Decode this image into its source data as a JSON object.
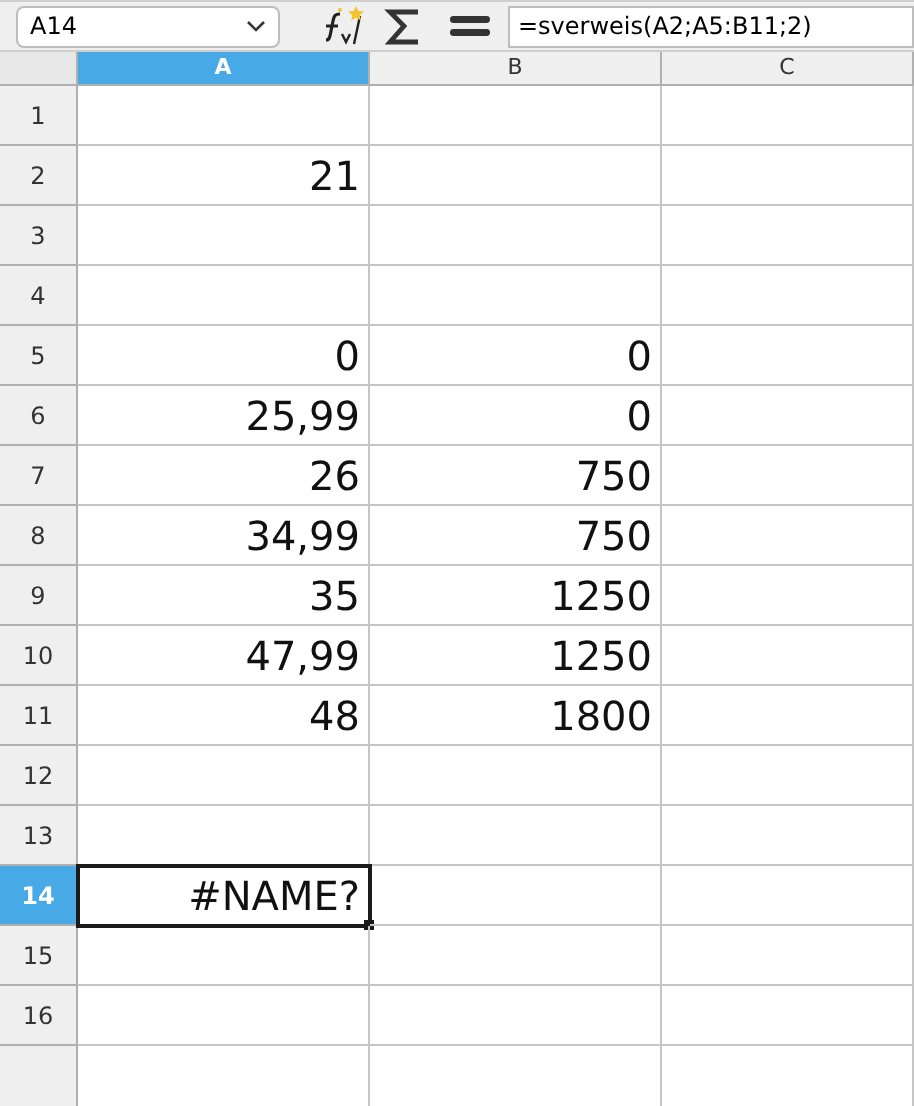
{
  "toolbar": {
    "name_box": "A14",
    "formula": "=sverweis(A2;A5:B11;2)"
  },
  "columns": [
    {
      "label": "A",
      "selected": true
    },
    {
      "label": "B",
      "selected": false
    },
    {
      "label": "C",
      "selected": false
    }
  ],
  "rows": [
    {
      "label": "1",
      "selected": false
    },
    {
      "label": "2",
      "selected": false,
      "A": "21"
    },
    {
      "label": "3",
      "selected": false
    },
    {
      "label": "4",
      "selected": false
    },
    {
      "label": "5",
      "selected": false,
      "A": "0",
      "B": "0"
    },
    {
      "label": "6",
      "selected": false,
      "A": "25,99",
      "B": "0"
    },
    {
      "label": "7",
      "selected": false,
      "A": "26",
      "B": "750"
    },
    {
      "label": "8",
      "selected": false,
      "A": "34,99",
      "B": "750"
    },
    {
      "label": "9",
      "selected": false,
      "A": "35",
      "B": "1250"
    },
    {
      "label": "10",
      "selected": false,
      "A": "47,99",
      "B": "1250"
    },
    {
      "label": "11",
      "selected": false,
      "A": "48",
      "B": "1800"
    },
    {
      "label": "12",
      "selected": false
    },
    {
      "label": "13",
      "selected": false
    },
    {
      "label": "14",
      "selected": true,
      "A": "#NAME?"
    },
    {
      "label": "15",
      "selected": false
    },
    {
      "label": "16",
      "selected": false
    }
  ]
}
